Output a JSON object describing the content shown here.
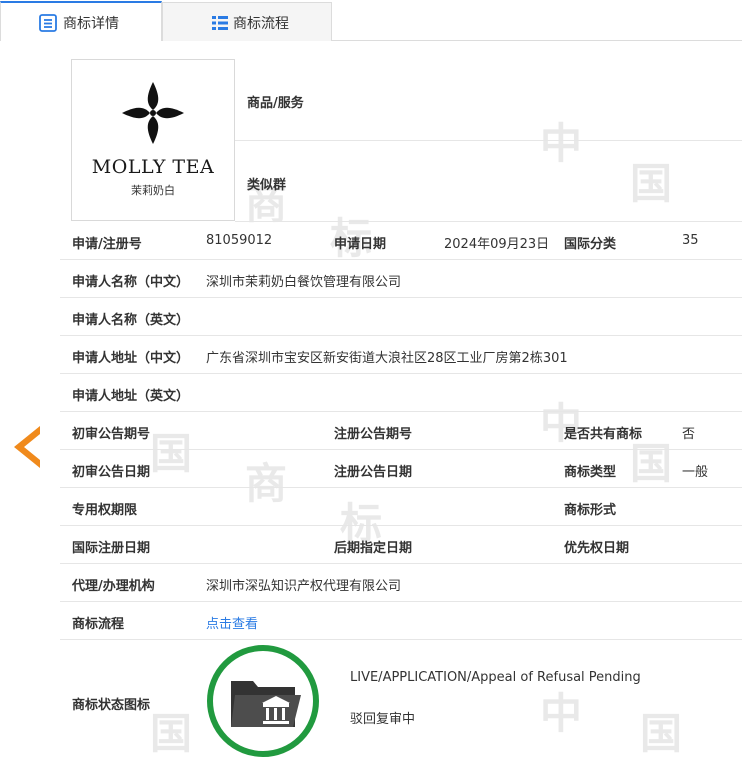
{
  "tabs": [
    {
      "label": "商标详情",
      "active": true,
      "icon": "list-icon"
    },
    {
      "label": "商标流程",
      "active": false,
      "icon": "table-icon"
    }
  ],
  "logo": {
    "name": "MOLLY TEA",
    "sub": "茉莉奶白"
  },
  "goods": {
    "label": "商品/服务",
    "similar_label": "类似群"
  },
  "fields": {
    "reg_no_label": "申请/注册号",
    "reg_no": "81059012",
    "apply_date_label": "申请日期",
    "apply_date": "2024年09月23日",
    "intl_class_label": "国际分类",
    "intl_class": "35",
    "applicant_cn_label": "申请人名称（中文）",
    "applicant_cn": "深圳市茉莉奶白餐饮管理有限公司",
    "applicant_en_label": "申请人名称（英文）",
    "address_cn_label": "申请人地址（中文）",
    "address_cn": "广东省深圳市宝安区新安街道大浪社区28区工业厂房第2栋301",
    "address_en_label": "申请人地址（英文）",
    "prelim_no_label": "初审公告期号",
    "reg_pub_no_label": "注册公告期号",
    "shared_label": "是否共有商标",
    "shared": "否",
    "prelim_date_label": "初审公告日期",
    "reg_pub_date_label": "注册公告日期",
    "tm_type_label": "商标类型",
    "tm_type": "一般",
    "exclusive_label": "专用权期限",
    "tm_form_label": "商标形式",
    "intl_reg_date_label": "国际注册日期",
    "later_date_label": "后期指定日期",
    "priority_date_label": "优先权日期",
    "agent_label": "代理/办理机构",
    "agent": "深圳市深弘知识产权代理有限公司",
    "flow_label": "商标流程",
    "flow_link": "点击查看",
    "status_icon_label": "商标状态图标",
    "status_en": "LIVE/APPLICATION/Appeal of Refusal Pending",
    "status_cn": "驳回复审中"
  },
  "colors": {
    "accent": "#2a7be4",
    "arrow": "#f08a1c",
    "status_ring": "#219a3f"
  }
}
